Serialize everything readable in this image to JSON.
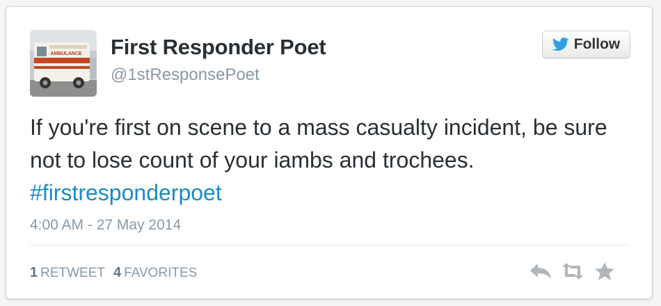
{
  "tweet": {
    "author": {
      "name": "First Responder Poet",
      "handle": "@1stResponsePoet"
    },
    "follow_label": "Follow",
    "text_main": "If you're first on scene to a mass casualty incident, be sure not to lose count of your iambs and trochees.",
    "hashtag": "#firstresponderpoet",
    "timestamp": "4:00 AM - 27 May 2014",
    "retweets": {
      "count": "1",
      "label": "RETWEET"
    },
    "favorites": {
      "count": "4",
      "label": "FAVORITES"
    },
    "avatar_text": "AMBULANCE"
  },
  "colors": {
    "link": "#1b8bc2",
    "twitter_bird": "#2e9ee6",
    "muted": "#8899a6",
    "action_icon": "#b1b6bb"
  },
  "icons": [
    "twitter-bird-icon",
    "reply-icon",
    "retweet-icon",
    "favorite-star-icon"
  ]
}
